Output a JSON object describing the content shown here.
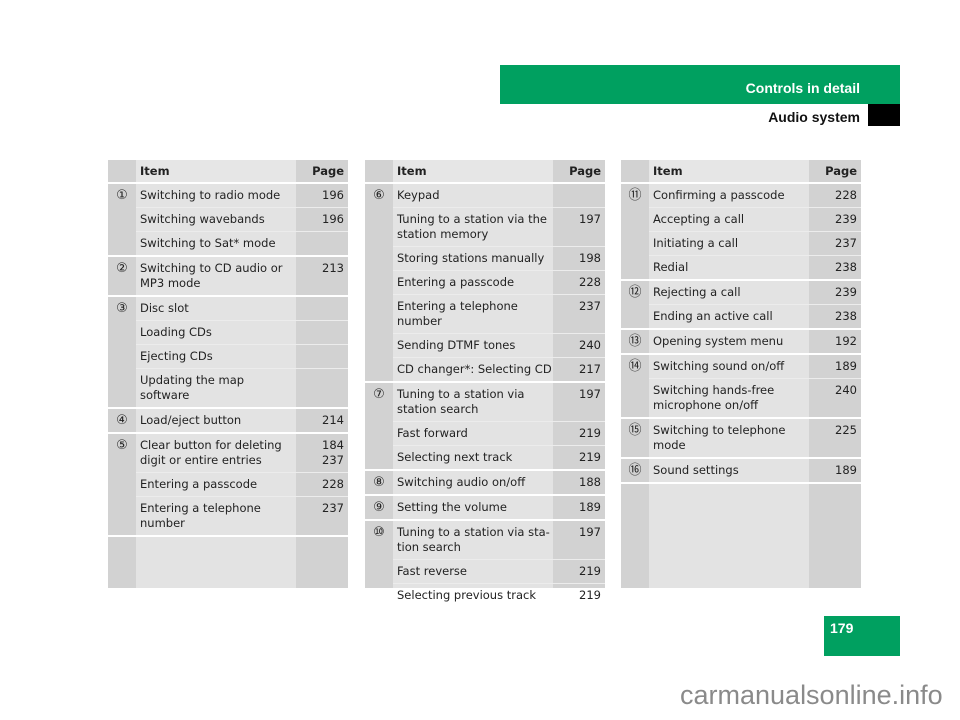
{
  "header": {
    "section": "Controls in detail",
    "subsection": "Audio system"
  },
  "colors": {
    "accent": "#00a060",
    "cell_light": "#e3e3e3",
    "cell_dark": "#d2d2d2"
  },
  "page_number": "179",
  "watermark": "carmanualsonline.info",
  "tables": [
    {
      "col_item": "Item",
      "col_page": "Page",
      "groups": [
        {
          "num": "①",
          "rows": [
            {
              "item": "Switching to radio mode",
              "page": "196"
            },
            {
              "item": "Switching wavebands",
              "page": "196"
            },
            {
              "item": "Switching to Sat* mode",
              "page": ""
            }
          ]
        },
        {
          "num": "②",
          "rows": [
            {
              "item": "Switching to CD audio or MP3 mode",
              "page": "213"
            }
          ]
        },
        {
          "num": "③",
          "rows": [
            {
              "item": "Disc slot",
              "page": ""
            },
            {
              "item": "Loading CDs",
              "page": ""
            },
            {
              "item": "Ejecting CDs",
              "page": ""
            },
            {
              "item": "Updating the map software",
              "page": ""
            }
          ]
        },
        {
          "num": "④",
          "rows": [
            {
              "item": "Load/eject button",
              "page": "214"
            }
          ]
        },
        {
          "num": "⑤",
          "rows": [
            {
              "item": "Clear button for deleting digit or entire entries",
              "page": "184\n237"
            },
            {
              "item": "Entering a passcode",
              "page": "228"
            },
            {
              "item": "Entering a telephone number",
              "page": "237"
            }
          ]
        }
      ]
    },
    {
      "col_item": "Item",
      "col_page": "Page",
      "groups": [
        {
          "num": "⑥",
          "rows": [
            {
              "item": "Keypad",
              "page": ""
            },
            {
              "item": "Tuning to a station via the station memory",
              "page": "197"
            },
            {
              "item": "Storing stations manually",
              "page": "198"
            },
            {
              "item": "Entering a passcode",
              "page": "228"
            },
            {
              "item": "Entering a telephone number",
              "page": "237"
            },
            {
              "item": "Sending DTMF tones",
              "page": "240"
            },
            {
              "item": "CD changer*: Selecting CD",
              "page": "217"
            }
          ]
        },
        {
          "num": "⑦",
          "rows": [
            {
              "item": "Tuning to a station via station search",
              "page": "197"
            },
            {
              "item": "Fast forward",
              "page": "219"
            },
            {
              "item": "Selecting next track",
              "page": "219"
            }
          ]
        },
        {
          "num": "⑧",
          "rows": [
            {
              "item": "Switching audio on/off",
              "page": "188"
            }
          ]
        },
        {
          "num": "⑨",
          "rows": [
            {
              "item": "Setting the volume",
              "page": "189"
            }
          ]
        },
        {
          "num": "⑩",
          "rows": [
            {
              "item": "Tuning to a station via sta-tion search",
              "page": "197"
            },
            {
              "item": "Fast reverse",
              "page": "219"
            },
            {
              "item": "Selecting previous track",
              "page": "219"
            }
          ]
        }
      ]
    },
    {
      "col_item": "Item",
      "col_page": "Page",
      "groups": [
        {
          "num": "⑪",
          "rows": [
            {
              "item": "Confirming a passcode",
              "page": "228"
            },
            {
              "item": "Accepting a call",
              "page": "239"
            },
            {
              "item": "Initiating a call",
              "page": "237"
            },
            {
              "item": "Redial",
              "page": "238"
            }
          ]
        },
        {
          "num": "⑫",
          "rows": [
            {
              "item": "Rejecting a call",
              "page": "239"
            },
            {
              "item": "Ending an active call",
              "page": "238"
            }
          ]
        },
        {
          "num": "⑬",
          "rows": [
            {
              "item": "Opening system menu",
              "page": "192"
            }
          ]
        },
        {
          "num": "⑭",
          "rows": [
            {
              "item": "Switching sound on/off",
              "page": "189"
            },
            {
              "item": "Switching hands-free microphone on/off",
              "page": "240"
            }
          ]
        },
        {
          "num": "⑮",
          "rows": [
            {
              "item": "Switching to telephone mode",
              "page": "225"
            }
          ]
        },
        {
          "num": "⑯",
          "rows": [
            {
              "item": "Sound settings",
              "page": "189"
            }
          ]
        }
      ]
    }
  ]
}
